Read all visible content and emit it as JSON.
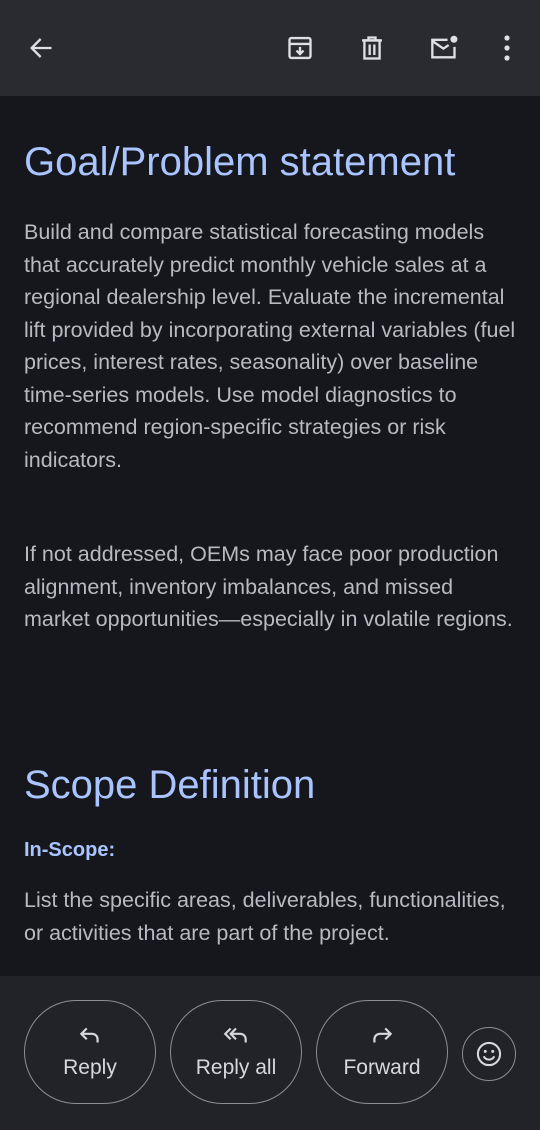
{
  "toolbar": {
    "back_icon": "arrow-left-icon",
    "archive_icon": "archive-icon",
    "delete_icon": "trash-icon",
    "unread_icon": "mark-unread-icon",
    "more_icon": "more-vertical-icon"
  },
  "email": {
    "heading_1": "Goal/Problem statement",
    "paragraph_1": "Build and compare statistical forecasting models that accurately predict monthly vehicle sales at a regional dealership level. Evaluate the incremental lift provided by incorporating external variables (fuel prices, interest rates, seasonality) over baseline time-series models. Use model diagnostics to recommend region-specific strategies or risk indicators.",
    "paragraph_2": "If not addressed, OEMs may face poor production alignment, inventory imbalances, and missed market opportunities—especially in volatile regions.",
    "heading_2": "Scope Definition",
    "subheading_in_scope": "In-Scope:",
    "paragraph_3": "List the specific areas, deliverables, functionalities, or activities that are part of the project."
  },
  "actions": {
    "reply_label": "Reply",
    "reply_all_label": "Reply all",
    "forward_label": "Forward",
    "emoji_icon": "emoji-smile-icon"
  },
  "colors": {
    "background": "#16171c",
    "bar": "#2a2b30",
    "heading": "#a9c4ff",
    "body_text": "#b9bac0"
  }
}
